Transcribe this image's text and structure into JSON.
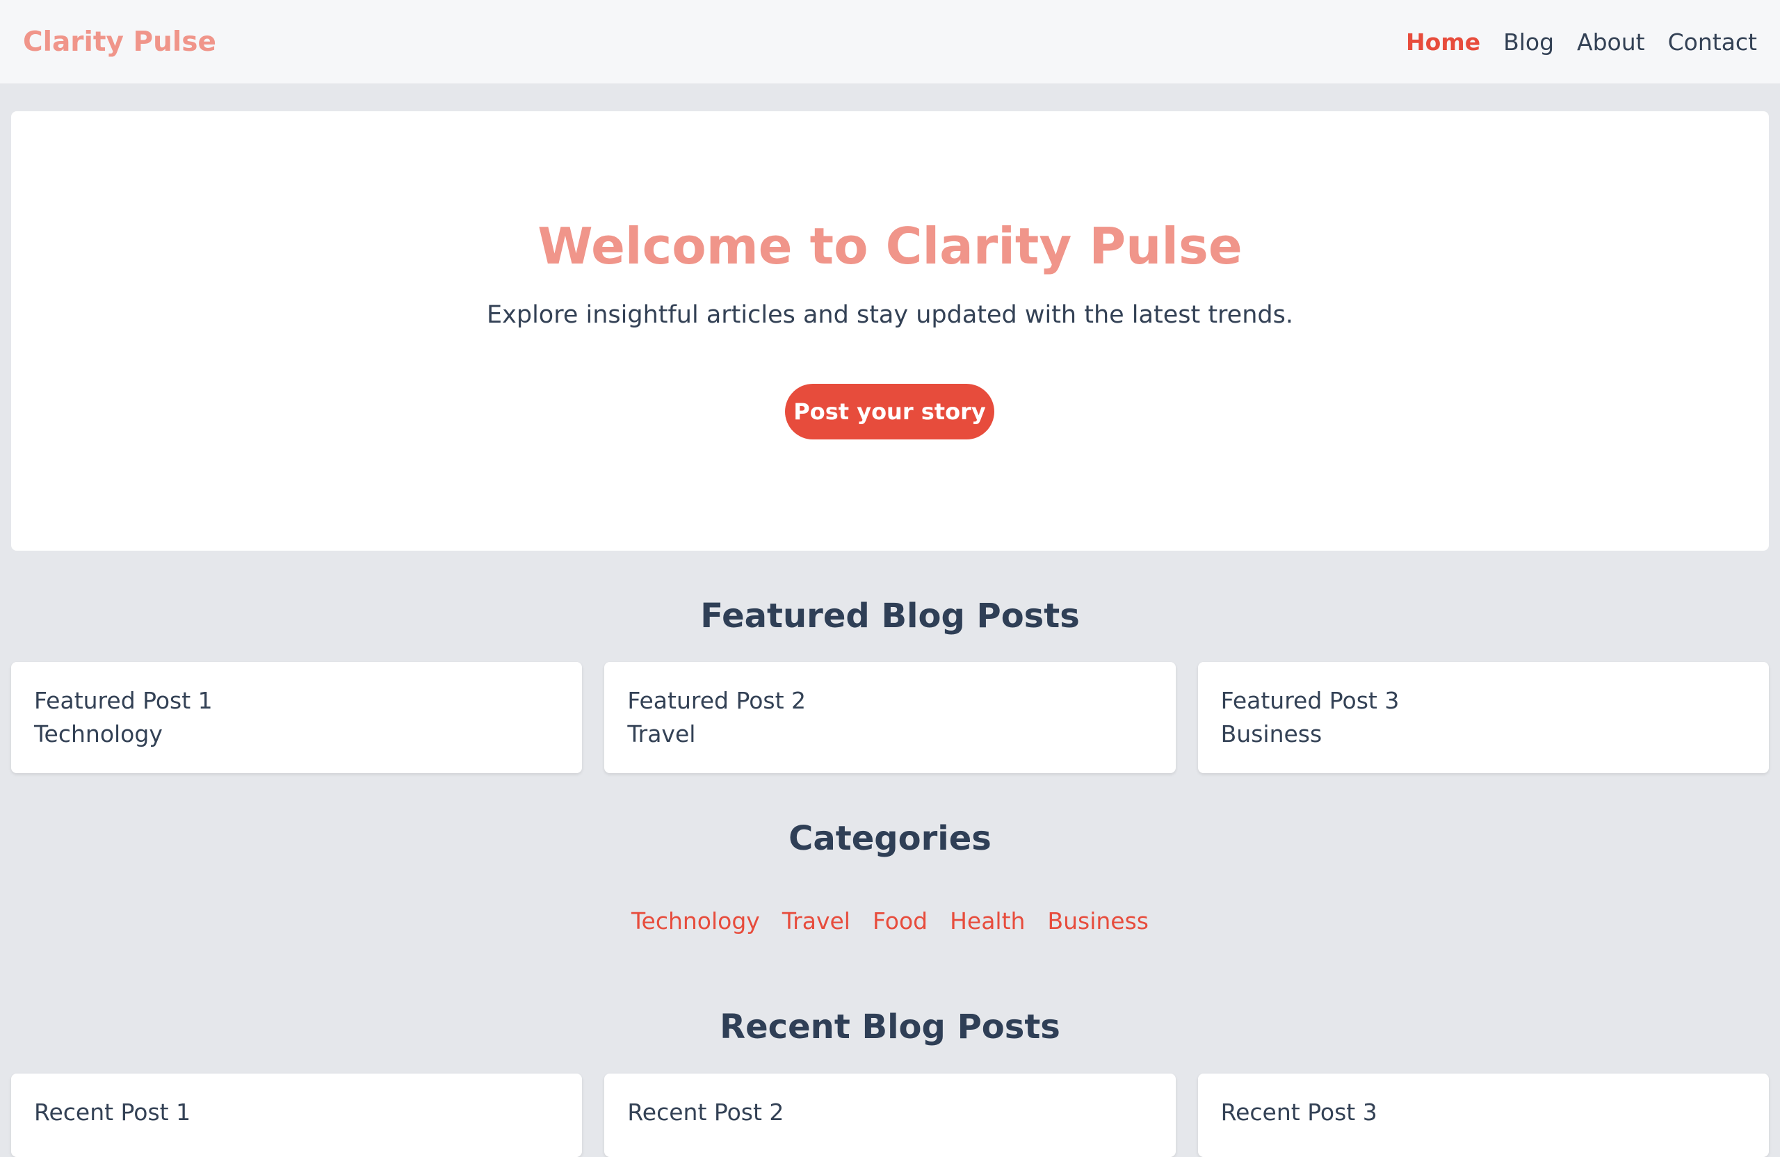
{
  "header": {
    "brand": "Clarity Pulse",
    "nav": [
      {
        "label": "Home",
        "active": true
      },
      {
        "label": "Blog",
        "active": false
      },
      {
        "label": "About",
        "active": false
      },
      {
        "label": "Contact",
        "active": false
      }
    ]
  },
  "hero": {
    "title": "Welcome to Clarity Pulse",
    "subtitle": "Explore insightful articles and stay updated with the latest trends.",
    "cta_label": "Post your story"
  },
  "featured": {
    "heading": "Featured Blog Posts",
    "posts": [
      {
        "title": "Featured Post 1",
        "category": "Technology"
      },
      {
        "title": "Featured Post 2",
        "category": "Travel"
      },
      {
        "title": "Featured Post 3",
        "category": "Business"
      }
    ]
  },
  "categories": {
    "heading": "Categories",
    "items": [
      "Technology",
      "Travel",
      "Food",
      "Health",
      "Business"
    ]
  },
  "recent": {
    "heading": "Recent Blog Posts",
    "posts": [
      {
        "title": "Recent Post 1"
      },
      {
        "title": "Recent Post 2"
      },
      {
        "title": "Recent Post 3"
      }
    ]
  },
  "colors": {
    "accent": "#e74c3c",
    "brand": "#f0958a",
    "background": "#e5e7eb",
    "text": "#334155"
  }
}
